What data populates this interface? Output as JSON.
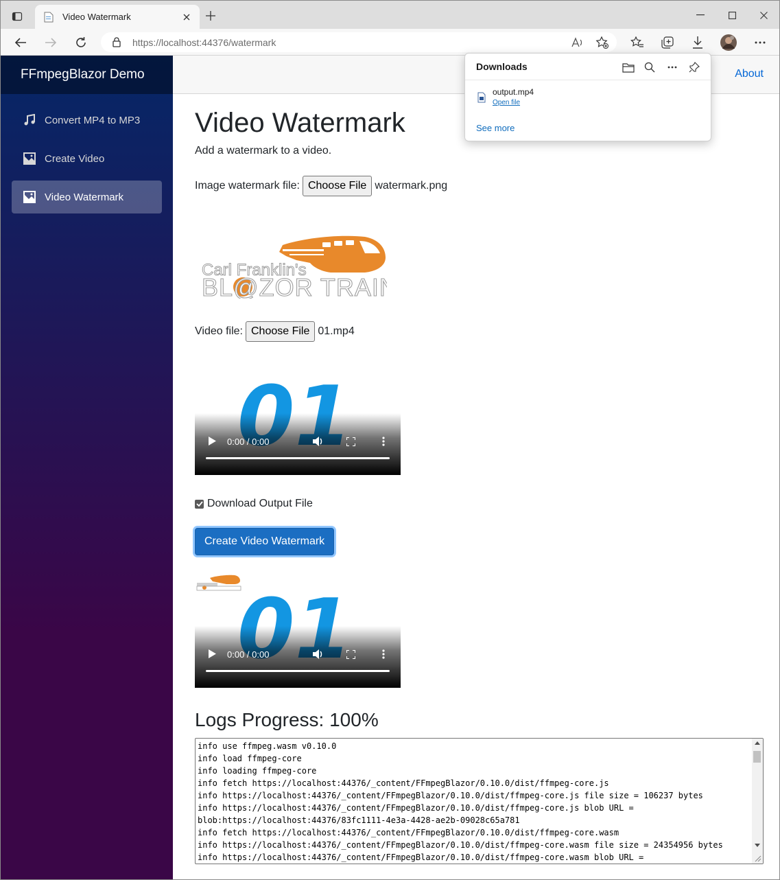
{
  "browser": {
    "tab_title": "Video Watermark",
    "url_host": "https://localhost",
    "url_rest": ":44376/watermark"
  },
  "downloads": {
    "title": "Downloads",
    "file_name": "output.mp4",
    "open_label": "Open file",
    "see_more": "See more"
  },
  "app": {
    "brand": "FFmpegBlazor Demo",
    "about": "About",
    "nav": [
      {
        "label": "Convert MP4 to MP3",
        "icon": "music-note-icon"
      },
      {
        "label": "Create Video",
        "icon": "image-icon"
      },
      {
        "label": "Video Watermark",
        "icon": "image-icon"
      }
    ]
  },
  "page": {
    "title": "Video Watermark",
    "subtitle": "Add a watermark to a video.",
    "image_label": "Image watermark file:",
    "image_button": "Choose File",
    "image_file": "watermark.png",
    "logo_line1": "Carl Franklin's",
    "logo_line2": "BL@ZOR TRAIN",
    "video_label": "Video file:",
    "video_button": "Choose File",
    "video_file": "01.mp4",
    "input_video": {
      "frame_text": "01",
      "time": "0:00 / 0:00"
    },
    "download_checkbox_label": "Download Output File",
    "download_checked": true,
    "create_button": "Create Video Watermark",
    "output_video": {
      "frame_text": "01",
      "time": "0:00 / 0:00"
    },
    "logs_title": "Logs Progress: 100%",
    "logs": [
      "info use ffmpeg.wasm v0.10.0",
      "info load ffmpeg-core",
      "info loading ffmpeg-core",
      "info fetch https://localhost:44376/_content/FFmpegBlazor/0.10.0/dist/ffmpeg-core.js",
      "info https://localhost:44376/_content/FFmpegBlazor/0.10.0/dist/ffmpeg-core.js file size = 106237 bytes",
      "info https://localhost:44376/_content/FFmpegBlazor/0.10.0/dist/ffmpeg-core.js blob URL =",
      "blob:https://localhost:44376/83fc1111-4e3a-4428-ae2b-09028c65a781",
      "info fetch https://localhost:44376/_content/FFmpegBlazor/0.10.0/dist/ffmpeg-core.wasm",
      "info https://localhost:44376/_content/FFmpegBlazor/0.10.0/dist/ffmpeg-core.wasm file size = 24354956 bytes",
      "info https://localhost:44376/_content/FFmpegBlazor/0.10.0/dist/ffmpeg-core.wasm blob URL ="
    ]
  },
  "colors": {
    "sidebar_top": "#052767",
    "sidebar_bottom": "#3a0647",
    "primary": "#1b6ec2",
    "link": "#0366d6",
    "logo_orange": "#e8892b",
    "video_blue": "#1396e2"
  }
}
